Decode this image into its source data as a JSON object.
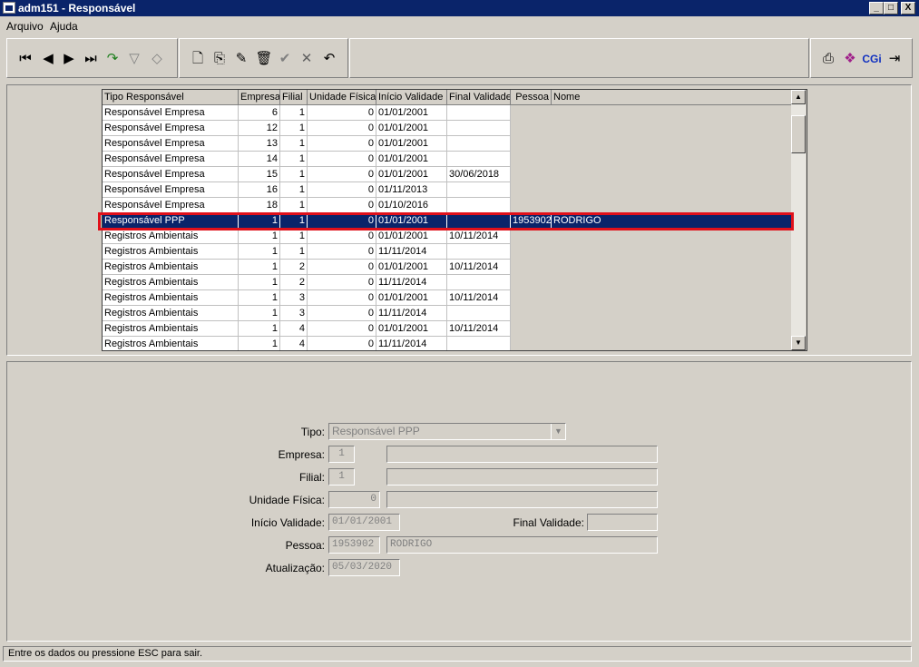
{
  "window": {
    "title": "adm151 - Responsável",
    "minimize": "_",
    "maximize": "□",
    "close": "X"
  },
  "menu": {
    "items": [
      "Arquivo",
      "Ajuda"
    ]
  },
  "toolbar": {
    "nav": [
      {
        "icon": "first-record-icon",
        "glyph": "⏮"
      },
      {
        "icon": "prev-record-icon",
        "glyph": "◀"
      },
      {
        "icon": "next-record-icon",
        "glyph": "▶"
      },
      {
        "icon": "last-record-icon",
        "glyph": "⏭"
      },
      {
        "icon": "goto-icon",
        "glyph": "↷"
      },
      {
        "icon": "filter-icon",
        "glyph": "▽"
      },
      {
        "icon": "search-icon",
        "glyph": "◇"
      }
    ],
    "edit": [
      {
        "icon": "new-document-icon",
        "glyph": "🗋"
      },
      {
        "icon": "copy-icon",
        "glyph": "⎘"
      },
      {
        "icon": "edit-pencil-icon",
        "glyph": "✎"
      },
      {
        "icon": "delete-trash-icon",
        "glyph": "🗑"
      },
      {
        "icon": "save-check-icon",
        "glyph": "✔"
      },
      {
        "icon": "cancel-x-icon",
        "glyph": "✕"
      },
      {
        "icon": "undo-icon",
        "glyph": "↶"
      }
    ],
    "right": [
      {
        "icon": "print-icon",
        "glyph": "⎙"
      },
      {
        "icon": "help-book-icon",
        "glyph": "❖"
      },
      {
        "icon": "cgi-icon",
        "glyph": "CGi"
      },
      {
        "icon": "exit-door-icon",
        "glyph": "⇥"
      }
    ]
  },
  "grid": {
    "columns": [
      "Tipo Responsável",
      "Empresa",
      "Filial",
      "Unidade Física",
      "Início Validade",
      "Final Validade",
      "Pessoa",
      "Nome"
    ],
    "rows": [
      [
        "Responsável Empresa",
        "6",
        "1",
        "0",
        "01/01/2001",
        "",
        "",
        ""
      ],
      [
        "Responsável Empresa",
        "12",
        "1",
        "0",
        "01/01/2001",
        "",
        "",
        ""
      ],
      [
        "Responsável Empresa",
        "13",
        "1",
        "0",
        "01/01/2001",
        "",
        "",
        ""
      ],
      [
        "Responsável Empresa",
        "14",
        "1",
        "0",
        "01/01/2001",
        "",
        "",
        ""
      ],
      [
        "Responsável Empresa",
        "15",
        "1",
        "0",
        "01/01/2001",
        "30/06/2018",
        "",
        ""
      ],
      [
        "Responsável Empresa",
        "16",
        "1",
        "0",
        "01/11/2013",
        "",
        "",
        ""
      ],
      [
        "Responsável Empresa",
        "18",
        "1",
        "0",
        "01/10/2016",
        "",
        "",
        ""
      ],
      [
        "Responsável PPP",
        "1",
        "1",
        "0",
        "01/01/2001",
        "",
        "1953902",
        "RODRIGO"
      ],
      [
        "Registros Ambientais",
        "1",
        "1",
        "0",
        "01/01/2001",
        "10/11/2014",
        "",
        ""
      ],
      [
        "Registros Ambientais",
        "1",
        "1",
        "0",
        "11/11/2014",
        "",
        "",
        ""
      ],
      [
        "Registros Ambientais",
        "1",
        "2",
        "0",
        "01/01/2001",
        "10/11/2014",
        "",
        ""
      ],
      [
        "Registros Ambientais",
        "1",
        "2",
        "0",
        "11/11/2014",
        "",
        "",
        ""
      ],
      [
        "Registros Ambientais",
        "1",
        "3",
        "0",
        "01/01/2001",
        "10/11/2014",
        "",
        ""
      ],
      [
        "Registros Ambientais",
        "1",
        "3",
        "0",
        "11/11/2014",
        "",
        "",
        ""
      ],
      [
        "Registros Ambientais",
        "1",
        "4",
        "0",
        "01/01/2001",
        "10/11/2014",
        "",
        ""
      ],
      [
        "Registros Ambientais",
        "1",
        "4",
        "0",
        "11/11/2014",
        "",
        "",
        ""
      ]
    ],
    "selected_row": 7,
    "highlight_color": "#e0101a"
  },
  "form": {
    "tipo_label": "Tipo:",
    "tipo_value": "Responsável PPP",
    "empresa_label": "Empresa:",
    "empresa_value": "1",
    "empresa_desc": "",
    "filial_label": "Filial:",
    "filial_value": "1",
    "filial_desc": "",
    "unidade_label": "Unidade Física:",
    "unidade_value": "0",
    "unidade_desc": "",
    "inicio_label": "Início Validade:",
    "inicio_value": "01/01/2001",
    "final_label": "Final Validade:",
    "final_value": "",
    "pessoa_label": "Pessoa:",
    "pessoa_value": "1953902",
    "pessoa_nome": "RODRIGO",
    "atualizacao_label": "Atualização:",
    "atualizacao_value": "05/03/2020"
  },
  "status": {
    "text": "Entre os dados ou pressione ESC para sair."
  }
}
